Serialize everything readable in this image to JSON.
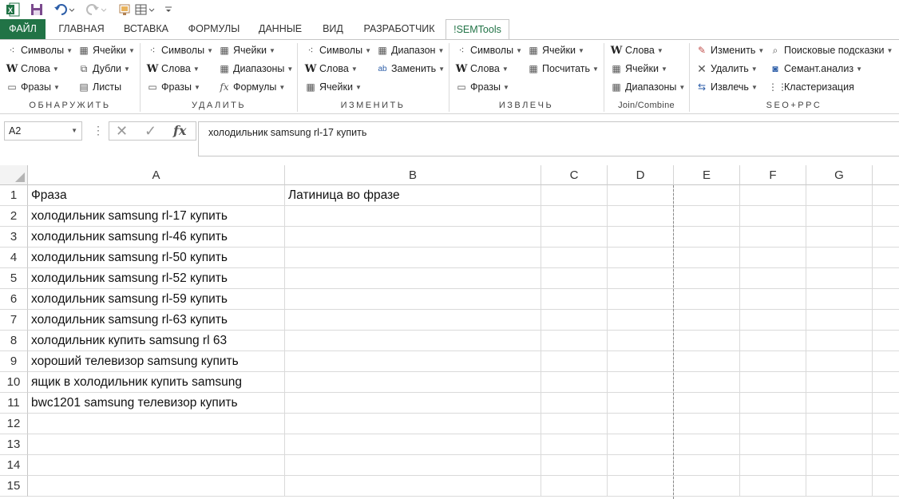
{
  "qat": {
    "items": [
      "excel-logo",
      "save",
      "undo",
      "redo",
      "paint",
      "table",
      "customize"
    ]
  },
  "tabs": [
    {
      "label": "ФАЙЛ",
      "type": "file"
    },
    {
      "label": "ГЛАВНАЯ"
    },
    {
      "label": "ВСТАВКА"
    },
    {
      "label": "ФОРМУЛЫ"
    },
    {
      "label": "ДАННЫЕ"
    },
    {
      "label": "ВИД"
    },
    {
      "label": "РАЗРАБОТЧИК"
    },
    {
      "label": "!SEMTools",
      "type": "active"
    }
  ],
  "ribbon": {
    "groups": [
      {
        "label": "ОБНАРУЖИТЬ",
        "buttons": [
          {
            "label": "Символы",
            "icon": "symbols-icon",
            "dropdown": true
          },
          {
            "label": "Ячейки",
            "icon": "cells-icon",
            "dropdown": true
          },
          {
            "label": "Слова",
            "icon": "w-icon",
            "dropdown": true
          },
          {
            "label": "Дубли",
            "icon": "duplicates-icon",
            "dropdown": true
          },
          {
            "label": "Фразы",
            "icon": "phrases-icon",
            "dropdown": true
          },
          {
            "label": "Листы",
            "icon": "sheets-icon",
            "dropdown": false
          }
        ]
      },
      {
        "label": "УДАЛИТЬ",
        "buttons": [
          {
            "label": "Символы",
            "icon": "symbols-icon",
            "dropdown": true
          },
          {
            "label": "Ячейки",
            "icon": "cells-icon",
            "dropdown": true
          },
          {
            "label": "Слова",
            "icon": "w-icon",
            "dropdown": true
          },
          {
            "label": "Диапазоны",
            "icon": "ranges-icon",
            "dropdown": true
          },
          {
            "label": "Фразы",
            "icon": "phrases-icon",
            "dropdown": true
          },
          {
            "label": "Формулы",
            "icon": "fx-icon",
            "dropdown": true
          }
        ]
      },
      {
        "label": "ИЗМЕНИТЬ",
        "buttons": [
          {
            "label": "Символы",
            "icon": "symbols-icon",
            "dropdown": true
          },
          {
            "label": "Диапазон",
            "icon": "cells-icon",
            "dropdown": true
          },
          {
            "label": "Слова",
            "icon": "w-icon",
            "dropdown": true
          },
          {
            "label": "Заменить",
            "icon": "replace-icon",
            "dropdown": true
          },
          {
            "label": "Ячейки",
            "icon": "cells-icon",
            "dropdown": true
          }
        ]
      },
      {
        "label": "ИЗВЛЕЧЬ",
        "buttons": [
          {
            "label": "Символы",
            "icon": "symbols-icon",
            "dropdown": true
          },
          {
            "label": "Ячейки",
            "icon": "cells-icon",
            "dropdown": true
          },
          {
            "label": "Слова",
            "icon": "w-icon",
            "dropdown": true
          },
          {
            "label": "Посчитать",
            "icon": "cells-icon",
            "dropdown": true
          },
          {
            "label": "Фразы",
            "icon": "phrases-icon",
            "dropdown": true
          }
        ]
      },
      {
        "label": "Join/Combine",
        "buttons": [
          {
            "label": "Слова",
            "icon": "w-icon",
            "dropdown": true
          },
          {
            "label": "Ячейки",
            "icon": "cells-icon",
            "dropdown": true
          },
          {
            "label": "Диапазоны",
            "icon": "ranges-icon",
            "dropdown": true
          }
        ]
      },
      {
        "label": "SEO+PPC",
        "buttons": [
          {
            "label": "Изменить",
            "icon": "modify-icon",
            "dropdown": true
          },
          {
            "label": "Поисковые подсказки",
            "icon": "search-hints-icon",
            "dropdown": true
          },
          {
            "label": "Удалить",
            "icon": "delete-icon",
            "dropdown": true
          },
          {
            "label": "Семант.анализ",
            "icon": "semantic-icon",
            "dropdown": true
          },
          {
            "label": "Извлечь",
            "icon": "extract-icon",
            "dropdown": true
          },
          {
            "label": "Кластеризация",
            "icon": "cluster-icon",
            "dropdown": false
          }
        ]
      }
    ]
  },
  "formula_bar": {
    "name_box": "A2",
    "value": "холодильник samsung rl-17 купить"
  },
  "columns": [
    "A",
    "B",
    "C",
    "D",
    "E",
    "F",
    "G"
  ],
  "rows": [
    {
      "num": "1",
      "a": "Фраза",
      "b": "Латиница во фразе"
    },
    {
      "num": "2",
      "a": "холодильник samsung rl-17 купить",
      "b": ""
    },
    {
      "num": "3",
      "a": "холодильник samsung rl-46 купить",
      "b": ""
    },
    {
      "num": "4",
      "a": "холодильник samsung rl-50 купить",
      "b": ""
    },
    {
      "num": "5",
      "a": "холодильник samsung rl-52 купить",
      "b": ""
    },
    {
      "num": "6",
      "a": "холодильник samsung rl-59 купить",
      "b": ""
    },
    {
      "num": "7",
      "a": "холодильник samsung rl-63 купить",
      "b": ""
    },
    {
      "num": "8",
      "a": "холодильник купить samsung rl 63",
      "b": ""
    },
    {
      "num": "9",
      "a": "хороший телевизор samsung купить",
      "b": ""
    },
    {
      "num": "10",
      "a": "ящик в холодильник купить samsung",
      "b": ""
    },
    {
      "num": "11",
      "a": "bwc1201 samsung телевизор купить",
      "b": ""
    },
    {
      "num": "12",
      "a": "",
      "b": ""
    },
    {
      "num": "13",
      "a": "",
      "b": ""
    },
    {
      "num": "14",
      "a": "",
      "b": ""
    },
    {
      "num": "15",
      "a": "",
      "b": ""
    }
  ],
  "colors": {
    "accent": "#217346"
  }
}
